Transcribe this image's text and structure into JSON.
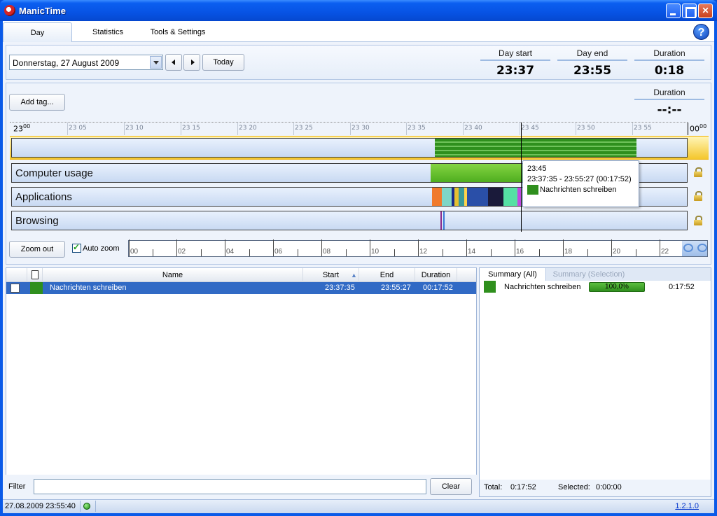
{
  "window": {
    "title": "ManicTime"
  },
  "tabs": [
    {
      "label": "Day"
    },
    {
      "label": "Statistics"
    },
    {
      "label": "Tools & Settings"
    }
  ],
  "help_label": "?",
  "date_nav": {
    "date_value": "Donnerstag, 27 August 2009",
    "today_label": "Today"
  },
  "stats": {
    "day_start": {
      "label": "Day start",
      "value": "23:37"
    },
    "day_end": {
      "label": "Day end",
      "value": "23:55"
    },
    "duration": {
      "label": "Duration",
      "value": "0:18"
    },
    "selection_duration": {
      "label": "Duration",
      "value": "--:--"
    }
  },
  "timeline": {
    "add_tag_label": "Add tag...",
    "ruler_labels": [
      "23",
      "2305",
      "2310",
      "2315",
      "2320",
      "2325",
      "2330",
      "2335",
      "2340",
      "2345",
      "2350",
      "2355",
      "00"
    ],
    "ruler_start_big": "23",
    "ruler_start_small": "00",
    "ruler_end_big": "00",
    "ruler_end_small": "00",
    "ruler_minutes": [
      "23 05",
      "23 10",
      "23 15",
      "23 20",
      "23 25",
      "23 30",
      "23 35",
      "23 40",
      "23 45",
      "23 50",
      "23 55"
    ],
    "tracks": [
      {
        "label": "Computer usage"
      },
      {
        "label": "Applications"
      },
      {
        "label": "Browsing"
      }
    ],
    "tooltip": {
      "time": "23:45",
      "range": "23:37:35 - 23:55:27 (00:17:52)",
      "name": "Nachrichten schreiben"
    },
    "zoom_out_label": "Zoom out",
    "auto_zoom_label": "Auto zoom",
    "zoom_hours": [
      "00",
      "02",
      "04",
      "06",
      "08",
      "10",
      "12",
      "14",
      "16",
      "18",
      "20",
      "22"
    ]
  },
  "list": {
    "columns": {
      "name": "Name",
      "start": "Start",
      "end": "End",
      "duration": "Duration"
    },
    "rows": [
      {
        "name": "Nachrichten schreiben",
        "start": "23:37:35",
        "end": "23:55:27",
        "duration": "00:17:52"
      }
    ],
    "filter_label": "Filter",
    "clear_label": "Clear"
  },
  "summary": {
    "tabs": [
      "Summary (All)",
      "Summary (Selection)"
    ],
    "items": [
      {
        "name": "Nachrichten schreiben",
        "percent_label": "100,0%",
        "percent": 100,
        "duration": "0:17:52"
      }
    ],
    "total_label": "Total:",
    "total_value": "0:17:52",
    "selected_label": "Selected:",
    "selected_value": "0:00:00"
  },
  "statusbar": {
    "datetime": "27.08.2009 23:55:40",
    "version": "1.2.1.0"
  },
  "colors": {
    "accent": "#316ac5",
    "activity_green": "#2f8f1d",
    "usage_green": "#69c22e"
  }
}
